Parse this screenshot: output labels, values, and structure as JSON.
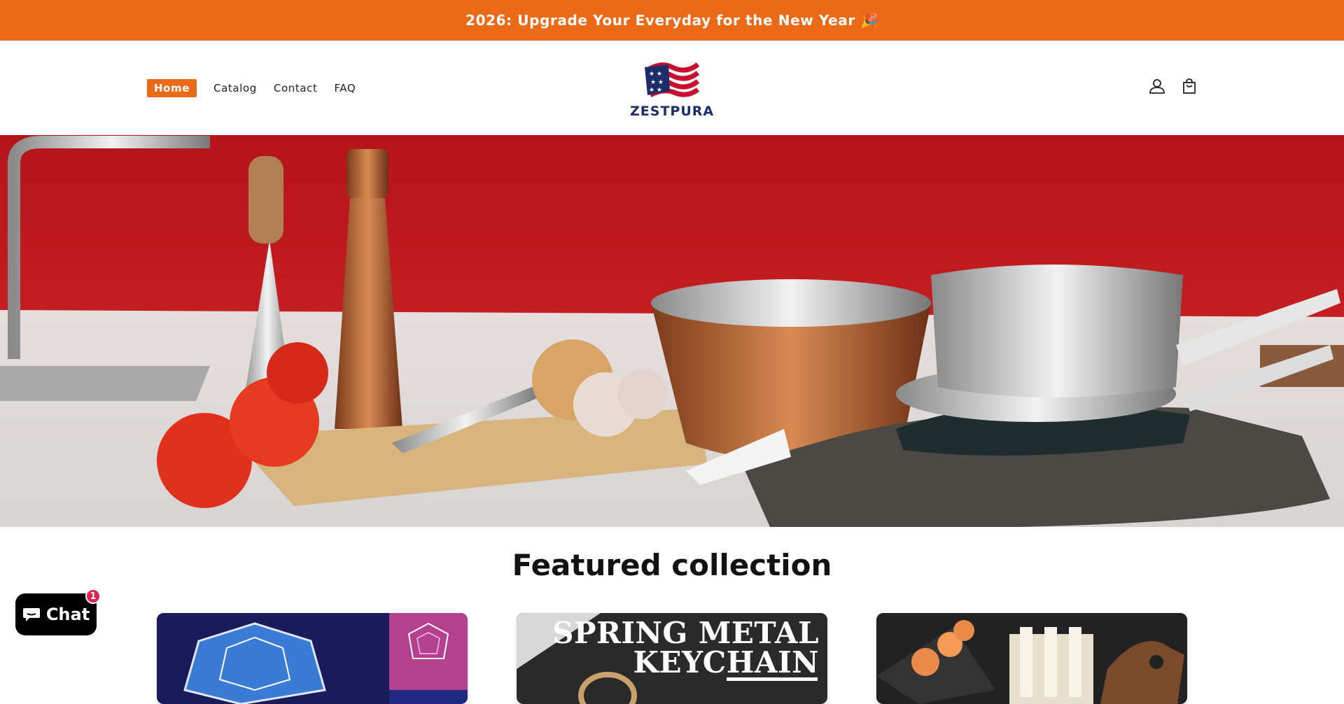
{
  "announcement": {
    "text": "2026: Upgrade Your Everyday for the New Year 🎉"
  },
  "nav": {
    "items": [
      {
        "label": "Home",
        "active": true
      },
      {
        "label": "Catalog"
      },
      {
        "label": "Contact"
      },
      {
        "label": "FAQ"
      }
    ]
  },
  "logo": {
    "text": "ZESTPURA",
    "icon": "us-flag-icon"
  },
  "header_icons": {
    "account": "account-icon",
    "cart": "cart-icon"
  },
  "hero": {
    "image": "kitchen-cookware-hero"
  },
  "featured": {
    "title": "Featured collection",
    "cards": [
      {
        "image": "illuminated-dodecahedron"
      },
      {
        "image": "spring-metal-keychain",
        "image_text": "SPRING METAL KEYCHAIN"
      },
      {
        "image": "sushi-maker-kit"
      }
    ]
  },
  "chat": {
    "label": "Chat",
    "badge_count": "1"
  },
  "colors": {
    "accent": "#ea6a17",
    "brand_navy": "#1d2d6b",
    "badge": "#e0234d"
  }
}
